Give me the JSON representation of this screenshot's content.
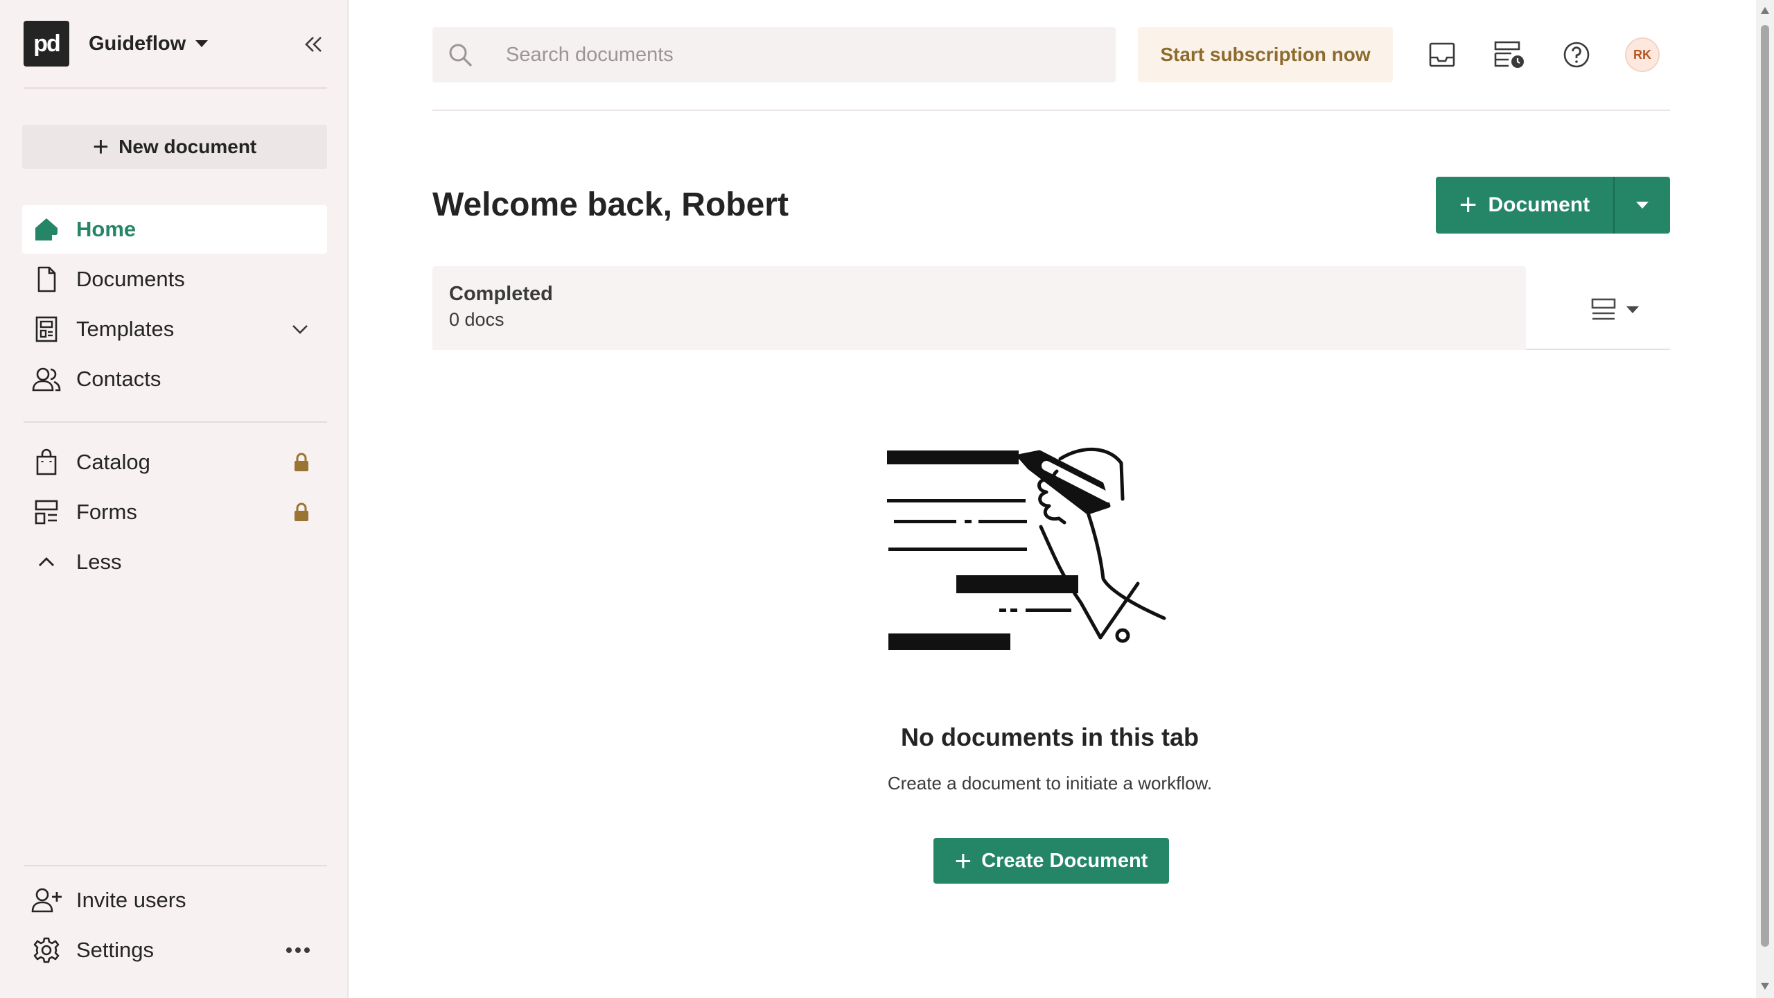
{
  "workspace": {
    "logo_text": "pd",
    "name": "Guideflow"
  },
  "sidebar": {
    "new_document_label": "New document",
    "primary_items": [
      {
        "label": "Home",
        "icon": "home-icon",
        "active": true
      },
      {
        "label": "Documents",
        "icon": "document-icon"
      },
      {
        "label": "Templates",
        "icon": "template-icon"
      },
      {
        "label": "Contacts",
        "icon": "contacts-icon"
      }
    ],
    "secondary_items": [
      {
        "label": "Catalog",
        "icon": "catalog-bag-icon",
        "locked": true
      },
      {
        "label": "Forms",
        "icon": "forms-icon",
        "locked": true
      },
      {
        "label": "Less",
        "icon": "chevron-up-icon"
      }
    ],
    "footer_items": [
      {
        "label": "Invite users",
        "icon": "add-user-icon"
      },
      {
        "label": "Settings",
        "icon": "gear-icon"
      }
    ]
  },
  "topbar": {
    "search_placeholder": "Search documents",
    "subscription_label": "Start subscription now",
    "avatar_initials": "RK"
  },
  "main": {
    "welcome": "Welcome back, Robert",
    "document_button_label": "Document",
    "tab": {
      "title": "Completed",
      "count": "0 docs"
    },
    "empty_state": {
      "title": "No documents in this tab",
      "subtitle": "Create a document to initiate a workflow.",
      "button_label": "Create Document"
    }
  },
  "colors": {
    "accent_green": "#248567",
    "sidebar_bg": "#f8f1f1",
    "subscription_text": "#8d6a2e",
    "lock_gold": "#9a7433"
  }
}
